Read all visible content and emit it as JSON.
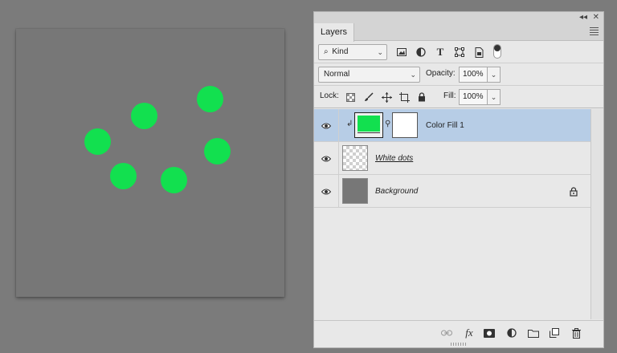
{
  "canvas": {
    "background": "#777777",
    "dot_color": "#12e04f",
    "dot_count": 6
  },
  "panel": {
    "tab_label": "Layers",
    "collapse_icon": "double-chevron-left-icon",
    "close_icon": "close-icon",
    "menu_icon": "hamburger-menu-icon",
    "filter": {
      "kind_label": "Kind",
      "icons": [
        "image-filter-icon",
        "adjustment-filter-icon",
        "type-filter-icon",
        "shape-filter-icon",
        "smart-object-filter-icon",
        "filter-toggle-icon"
      ]
    },
    "blend": {
      "mode": "Normal",
      "opacity_label": "Opacity:",
      "opacity_value": "100%"
    },
    "lock": {
      "label": "Lock:",
      "fill_label": "Fill:",
      "fill_value": "100%",
      "icons": [
        "lock-transparent-pixels-icon",
        "lock-image-pixels-icon",
        "lock-position-icon",
        "lock-artboard-icon",
        "lock-all-icon"
      ]
    },
    "layers": [
      {
        "name": "Color Fill 1",
        "type": "fill",
        "selected": true,
        "fill_color": "#12e04f",
        "clipped": true
      },
      {
        "name": "White dots",
        "type": "pixel",
        "selected": false,
        "underlined": true
      },
      {
        "name": "Background",
        "type": "background",
        "selected": false,
        "locked": true,
        "fill_color": "#777777"
      }
    ],
    "bottom_icons": [
      "link-layers-icon",
      "fx-icon",
      "add-mask-icon",
      "new-adjustment-icon",
      "new-group-icon",
      "new-layer-icon",
      "trash-icon"
    ],
    "colors": {
      "selection": "#b7cde6",
      "panel_bg": "#e8e8e8"
    }
  }
}
